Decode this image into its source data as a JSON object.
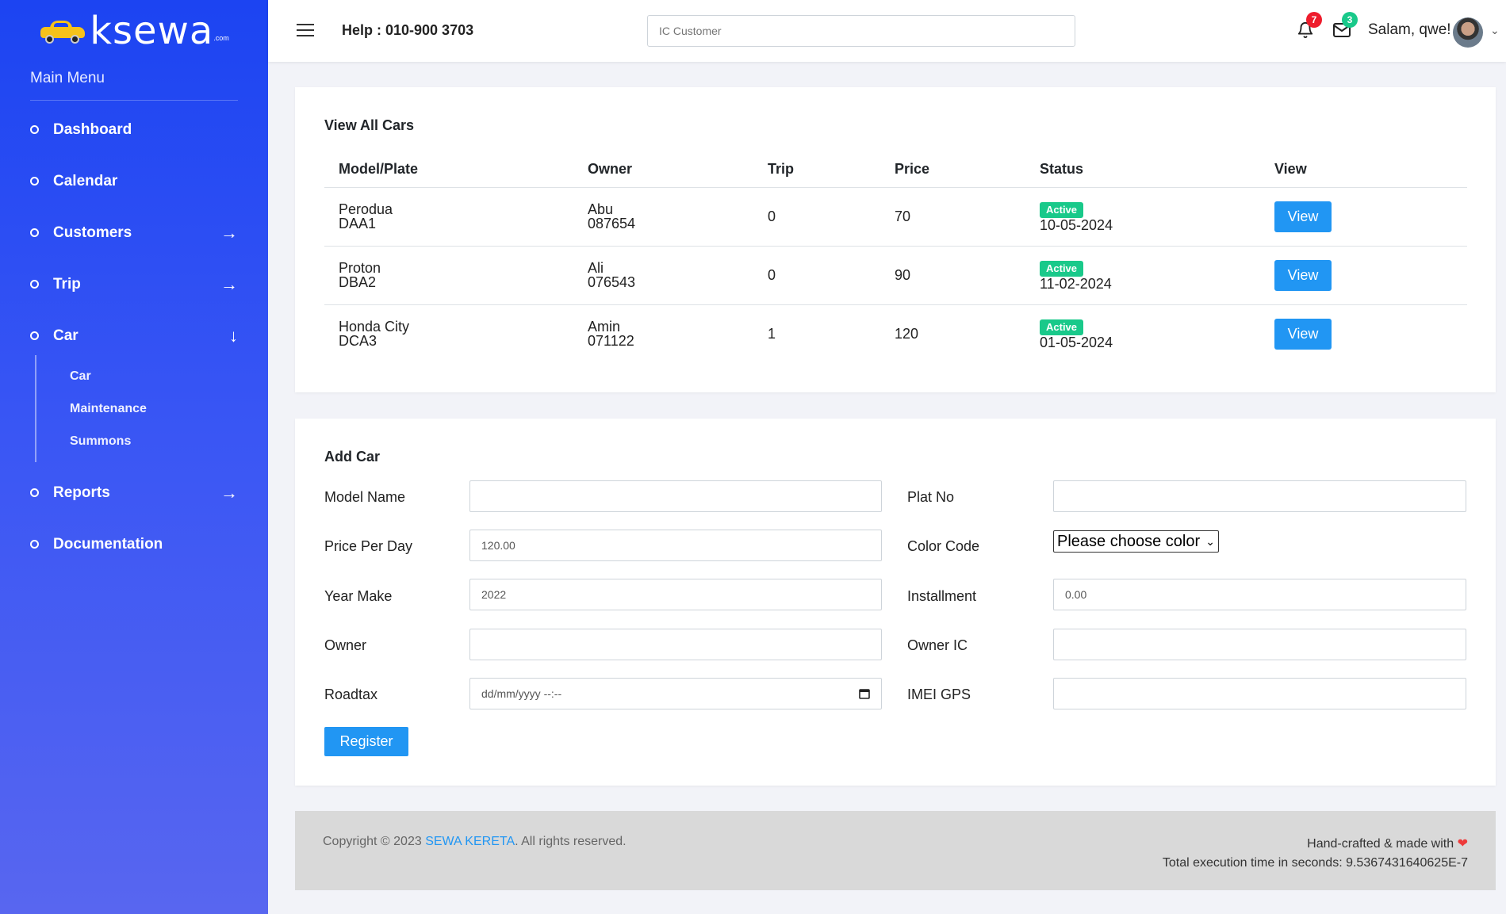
{
  "brand": {
    "name": "ksewa",
    "suffix": ".com"
  },
  "sidebar": {
    "title": "Main Menu",
    "items": [
      {
        "label": "Dashboard",
        "arrow": ""
      },
      {
        "label": "Calendar",
        "arrow": ""
      },
      {
        "label": "Customers",
        "arrow": "→"
      },
      {
        "label": "Trip",
        "arrow": "→"
      },
      {
        "label": "Car",
        "arrow": "↓"
      },
      {
        "label": "Reports",
        "arrow": "→"
      },
      {
        "label": "Documentation",
        "arrow": ""
      }
    ],
    "car_sub": [
      "Car",
      "Maintenance",
      "Summons"
    ]
  },
  "header": {
    "help": "Help : 010-900 3703",
    "search_placeholder": "IC Customer",
    "notif_count": "7",
    "mail_count": "3",
    "greeting": "Salam, qwe!"
  },
  "cars": {
    "title": "View All Cars",
    "columns": [
      "Model/Plate",
      "Owner",
      "Trip",
      "Price",
      "Status",
      "View"
    ],
    "rows": [
      {
        "model": "Perodua",
        "plate": "DAA1",
        "owner": "Abu",
        "owner_ic": "087654",
        "trip": "0",
        "price": "70",
        "status": "Active",
        "date": "10-05-2024",
        "view": "View"
      },
      {
        "model": "Proton",
        "plate": "DBA2",
        "owner": "Ali",
        "owner_ic": "076543",
        "trip": "0",
        "price": "90",
        "status": "Active",
        "date": "11-02-2024",
        "view": "View"
      },
      {
        "model": "Honda City",
        "plate": "DCA3",
        "owner": "Amin",
        "owner_ic": "071122",
        "trip": "1",
        "price": "120",
        "status": "Active",
        "date": "01-05-2024",
        "view": "View"
      }
    ]
  },
  "form": {
    "title": "Add Car",
    "model_name": {
      "label": "Model Name",
      "value": ""
    },
    "plat_no": {
      "label": "Plat No",
      "value": ""
    },
    "price": {
      "label": "Price Per Day",
      "value": "120.00"
    },
    "color": {
      "label": "Color Code",
      "value": "Please choose color"
    },
    "year": {
      "label": "Year Make",
      "value": "2022"
    },
    "installment": {
      "label": "Installment",
      "value": "0.00"
    },
    "owner": {
      "label": "Owner",
      "value": ""
    },
    "owner_ic": {
      "label": "Owner IC",
      "value": ""
    },
    "roadtax": {
      "label": "Roadtax",
      "placeholder": "dd/mm/yyyy --:--"
    },
    "imei": {
      "label": "IMEI GPS",
      "value": ""
    },
    "register": "Register"
  },
  "footer": {
    "copy_prefix": "Copyright © 2023 ",
    "copy_link": "SEWA KERETA",
    "copy_suffix": ". All rights reserved.",
    "made_with": "Hand-crafted & made with",
    "exec_time": "Total execution time in seconds: 9.5367431640625E-7"
  },
  "colors": {
    "accent": "#2196f3",
    "badge_active": "#19c98a",
    "sidebar": "#1c44f2"
  }
}
